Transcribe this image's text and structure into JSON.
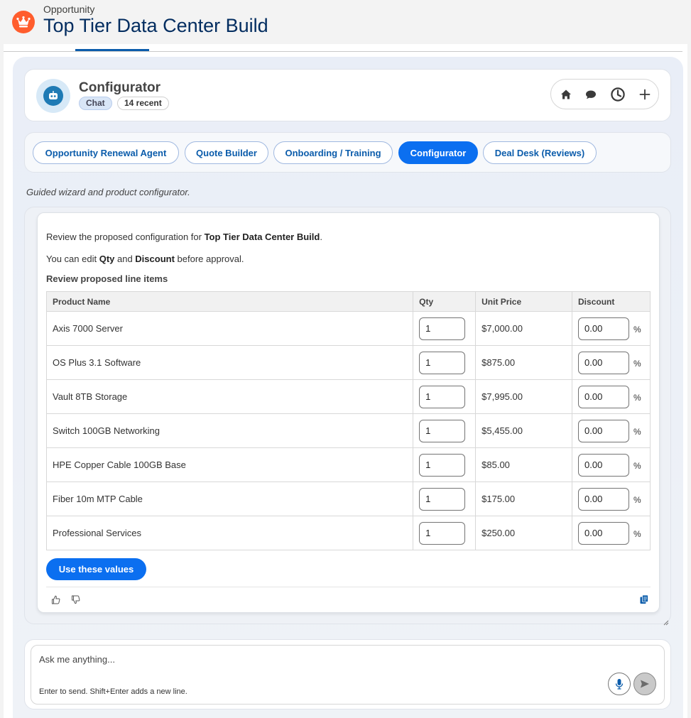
{
  "header": {
    "object_label": "Opportunity",
    "record_title": "Top Tier Data Center Build",
    "logo_icon": "crown-icon",
    "logo_color": "#ff5d2d"
  },
  "agent": {
    "name": "Configurator",
    "chat_badge": "Chat",
    "recent_badge": "14 recent",
    "actions": [
      "home-icon",
      "chat-bubble-icon",
      "history-icon",
      "plus-icon"
    ]
  },
  "tabs": [
    {
      "label": "Opportunity Renewal Agent",
      "active": false
    },
    {
      "label": "Quote Builder",
      "active": false
    },
    {
      "label": "Onboarding / Training",
      "active": false
    },
    {
      "label": "Configurator",
      "active": true
    },
    {
      "label": "Deal Desk (Reviews)",
      "active": false
    }
  ],
  "subtitle": "Guided wizard and product configurator.",
  "message": {
    "intro_prefix": "Review the proposed configuration for ",
    "intro_bold": "Top Tier Data Center Build",
    "intro_suffix": ".",
    "edit_prefix": "You can edit ",
    "edit_bold_1": "Qty",
    "edit_mid": " and ",
    "edit_bold_2": "Discount",
    "edit_suffix": " before approval.",
    "section_heading": "Review proposed line items",
    "columns": [
      "Product Name",
      "Qty",
      "Unit Price",
      "Discount"
    ],
    "percent_sign": "%",
    "rows": [
      {
        "product": "Axis 7000 Server",
        "qty": "1",
        "unit_price": "$7,000.00",
        "discount": "0.00"
      },
      {
        "product": "OS Plus 3.1 Software",
        "qty": "1",
        "unit_price": "$875.00",
        "discount": "0.00"
      },
      {
        "product": "Vault 8TB Storage",
        "qty": "1",
        "unit_price": "$7,995.00",
        "discount": "0.00"
      },
      {
        "product": "Switch 100GB Networking",
        "qty": "1",
        "unit_price": "$5,455.00",
        "discount": "0.00"
      },
      {
        "product": "HPE Copper Cable 100GB Base",
        "qty": "1",
        "unit_price": "$85.00",
        "discount": "0.00"
      },
      {
        "product": "Fiber 10m MTP Cable",
        "qty": "1",
        "unit_price": "$175.00",
        "discount": "0.00"
      },
      {
        "product": "Professional Services",
        "qty": "1",
        "unit_price": "$250.00",
        "discount": "0.00"
      }
    ],
    "submit_label": "Use these values"
  },
  "composer": {
    "placeholder": "Ask me anything...",
    "hint": "Enter to send. Shift+Enter adds a new line."
  },
  "colors": {
    "brand_blue": "#0b6ff0",
    "title_navy": "#032d60"
  }
}
